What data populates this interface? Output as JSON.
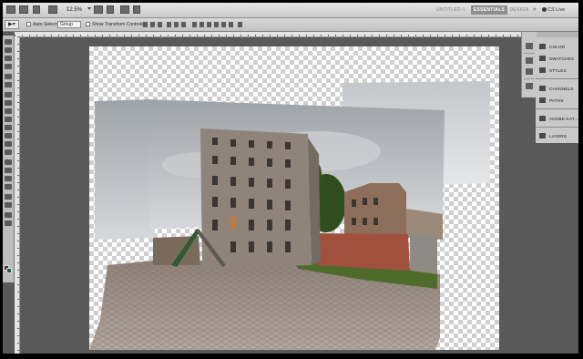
{
  "app_bar": {
    "zoom": "12.5%",
    "workspaces": [
      "UNTITLED-1",
      "ESSENTIALS",
      "DESIGN"
    ],
    "more": "»",
    "cs_live": "CS Live"
  },
  "options_bar": {
    "tool_preset": "▶▾",
    "auto_select_label": "Auto-Select:",
    "auto_select_value": "Group",
    "show_transform_label": "Show Transform Controls"
  },
  "panels": [
    {
      "label": "COLOR",
      "icon": "color-icon"
    },
    {
      "label": "SWATCHES",
      "icon": "swatches-icon"
    },
    {
      "label": "STYLES",
      "icon": "styles-icon"
    },
    {
      "label": "CHANNELS",
      "icon": "channels-icon"
    },
    {
      "label": "PATHS",
      "icon": "paths-icon"
    },
    {
      "label": "ADOBE KAT...",
      "icon": "kuler-icon"
    },
    {
      "label": "LAYERS",
      "icon": "layers-icon"
    }
  ],
  "colors": {
    "foreground": "#4a2a1c",
    "background": "#1c5a55",
    "active_workspace": "#8f8f8f"
  }
}
